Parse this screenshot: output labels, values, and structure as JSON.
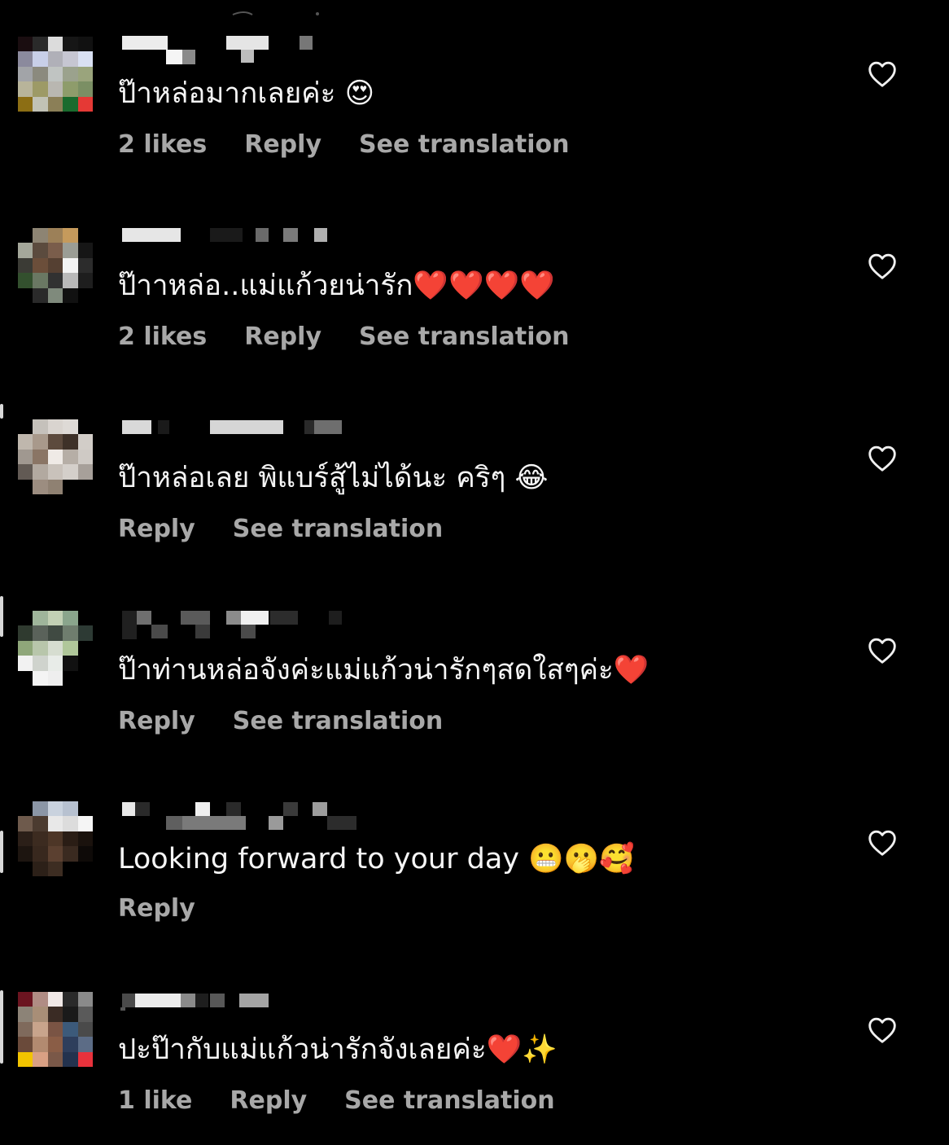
{
  "comments": [
    {
      "text": "ป๊าหล่อมากเลยค่ะ 😍",
      "likes": "2 likes",
      "reply": "Reply",
      "translate": "See translation"
    },
    {
      "text": "ป๊าาหล่อ..แม่แก้วยน่ารัก❤️❤️❤️❤️",
      "likes": "2 likes",
      "reply": "Reply",
      "translate": "See translation"
    },
    {
      "text": "ป๊าหล่อเลย พิแบร์สู้ไม่ได้นะ คริๆ 😂",
      "likes": "",
      "reply": "Reply",
      "translate": "See translation"
    },
    {
      "text": "ป๊าท่านหล่อจังค่ะแม่แก้วน่ารักๆสดใสๆค่ะ❤️",
      "likes": "",
      "reply": "Reply",
      "translate": "See translation"
    },
    {
      "text": "Looking forward to your day 😬🫢🥰",
      "likes": "",
      "reply": "Reply",
      "translate": ""
    },
    {
      "text": "ปะป๊ากับแม่แก้วน่ารักจังเลยค่ะ❤️✨",
      "likes": "1 like",
      "reply": "Reply",
      "translate": "See translation"
    }
  ],
  "icons": {
    "like": "heart-outline-icon",
    "avatar": "blurred-avatar",
    "username": "blurred-username"
  },
  "colors": {
    "background": "#000000",
    "text": "#f5f5f5",
    "secondary": "#a8a8a8"
  }
}
